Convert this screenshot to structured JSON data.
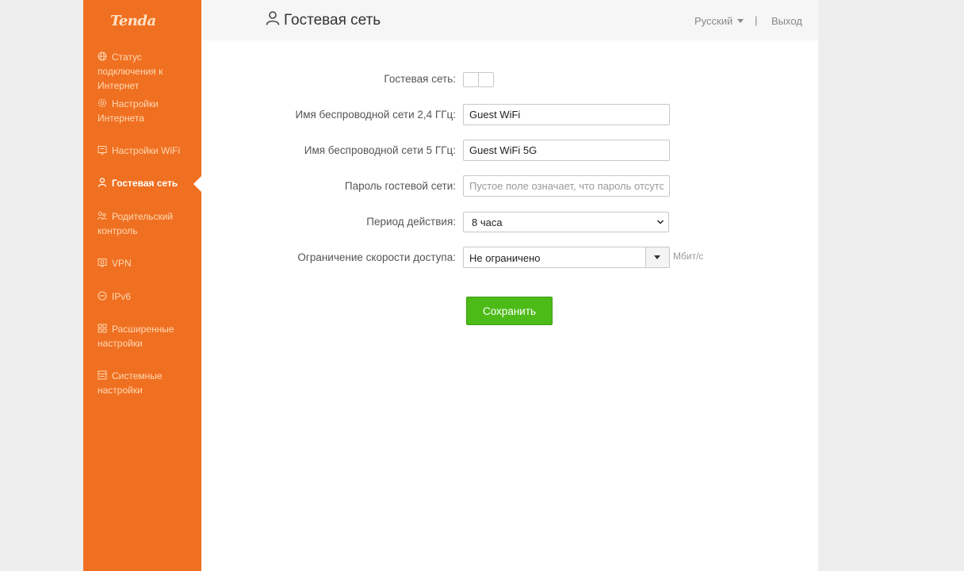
{
  "brand": {
    "logo_text": "Tenda",
    "accent_color": "#ef7021",
    "save_color": "#4cbb17"
  },
  "sidebar": {
    "items": [
      {
        "id": "internet-status",
        "icon": "globe-icon",
        "label": "Статус подключения к Интернет",
        "active": false
      },
      {
        "id": "internet-settings",
        "icon": "settings-icon",
        "label": "Настройки Интернета",
        "active": false
      },
      {
        "id": "wifi-settings",
        "icon": "wifi-settings-icon",
        "label": "Настройки WiFi",
        "active": false
      },
      {
        "id": "guest-network",
        "icon": "guest-user-icon",
        "label": "Гостевая сеть",
        "active": true
      },
      {
        "id": "parental-control",
        "icon": "parental-icon",
        "label": "Родительский контроль",
        "active": false
      },
      {
        "id": "vpn",
        "icon": "vpn-icon",
        "label": "VPN",
        "active": false
      },
      {
        "id": "ipv6",
        "icon": "ipv6-icon",
        "label": "IPv6",
        "active": false
      },
      {
        "id": "advanced",
        "icon": "grid-icon",
        "label": "Расширенные настройки",
        "active": false
      },
      {
        "id": "system",
        "icon": "system-icon",
        "label": "Системные настройки",
        "active": false
      }
    ]
  },
  "header": {
    "title": "Гостевая сеть",
    "title_icon": "guest-user-icon",
    "language": "Русский",
    "separator": "|",
    "logout": "Выход"
  },
  "form": {
    "guest_network_label": "Гостевая сеть:",
    "guest_network_enabled": false,
    "ssid_24_label": "Имя беспроводной сети 2,4 ГГц:",
    "ssid_24_value": "Guest WiFi",
    "ssid_5_label": "Имя беспроводной сети 5 ГГц:",
    "ssid_5_value": "Guest WiFi 5G",
    "password_label": "Пароль гостевой сети:",
    "password_placeholder": "Пустое поле означает, что пароль отсутствует",
    "password_value": "",
    "period_label": "Период действия:",
    "period_value": "8 часа",
    "speed_label": "Ограничение скорости доступа:",
    "speed_value": "Не ограничено",
    "speed_unit": "Мбит/с",
    "save_label": "Сохранить"
  }
}
